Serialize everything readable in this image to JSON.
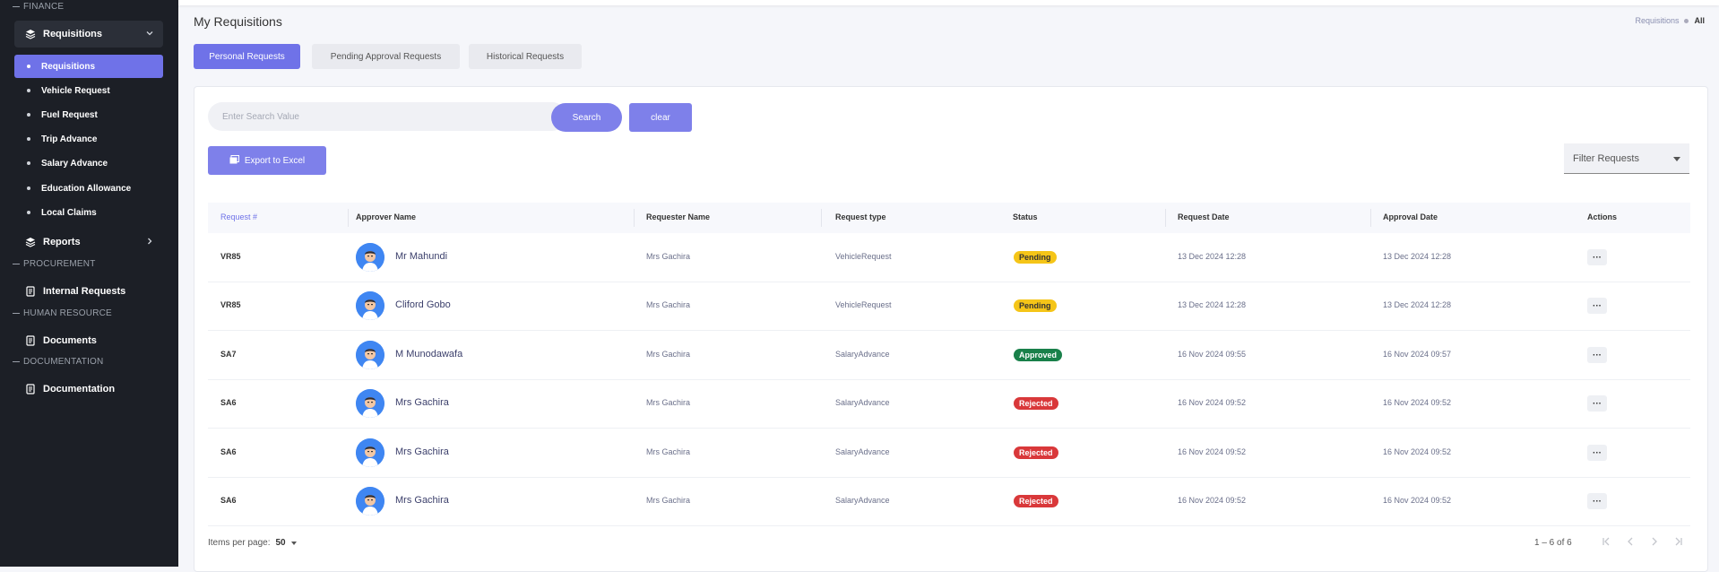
{
  "sidebar": {
    "sections": [
      "FINANCE",
      "PROCUREMENT",
      "HUMAN RESOURCE",
      "DOCUMENTATION"
    ],
    "group_requisitions": "Requisitions",
    "items": [
      "Requisitions",
      "Vehicle Request",
      "Fuel Request",
      "Trip Advance",
      "Salary Advance",
      "Education Allowance",
      "Local Claims"
    ],
    "reports": "Reports",
    "internal_requests": "Internal Requests",
    "documents": "Documents",
    "documentation": "Documentation"
  },
  "header": {
    "title": "My Requisitions",
    "breadcrumb": [
      "Requisitions",
      "All"
    ]
  },
  "tabs": [
    "Personal Requests",
    "Pending Approval Requests",
    "Historical Requests"
  ],
  "search": {
    "placeholder": "Enter Search Value",
    "button": "Search",
    "clear": "clear"
  },
  "export_label": "Export to Excel",
  "filter_label": "Filter Requests",
  "table": {
    "columns": [
      "Request #",
      "Approver Name",
      "Requester Name",
      "Request type",
      "Status",
      "Request Date",
      "Approval Date",
      "Actions"
    ],
    "rows": [
      {
        "id": "VR85",
        "approver": "Mr Mahundi",
        "requester": "Mrs Gachira",
        "type": "VehicleRequest",
        "status": "Pending",
        "request_date": "13 Dec 2024 12:28",
        "approval_date": "13 Dec 2024 12:28"
      },
      {
        "id": "VR85",
        "approver": "Cliford Gobo",
        "requester": "Mrs Gachira",
        "type": "VehicleRequest",
        "status": "Pending",
        "request_date": "13 Dec 2024 12:28",
        "approval_date": "13 Dec 2024 12:28"
      },
      {
        "id": "SA7",
        "approver": "M Munodawafa",
        "requester": "Mrs Gachira",
        "type": "SalaryAdvance",
        "status": "Approved",
        "request_date": "16 Nov 2024 09:55",
        "approval_date": "16 Nov 2024 09:57"
      },
      {
        "id": "SA6",
        "approver": "Mrs Gachira",
        "requester": "Mrs Gachira",
        "type": "SalaryAdvance",
        "status": "Rejected",
        "request_date": "16 Nov 2024 09:52",
        "approval_date": "16 Nov 2024 09:52"
      },
      {
        "id": "SA6",
        "approver": "Mrs Gachira",
        "requester": "Mrs Gachira",
        "type": "SalaryAdvance",
        "status": "Rejected",
        "request_date": "16 Nov 2024 09:52",
        "approval_date": "16 Nov 2024 09:52"
      },
      {
        "id": "SA6",
        "approver": "Mrs Gachira",
        "requester": "Mrs Gachira",
        "type": "SalaryAdvance",
        "status": "Rejected",
        "request_date": "16 Nov 2024 09:52",
        "approval_date": "16 Nov 2024 09:52"
      }
    ],
    "action_glyph": "···"
  },
  "footer": {
    "items_per_page_label": "Items per page:",
    "items_per_page_value": "50",
    "range": "1 – 6 of 6"
  },
  "colors": {
    "accent": "#6f72e8",
    "sidebar_bg": "#1c1f26",
    "pending": "#f5c518",
    "approved": "#19804a",
    "rejected": "#d9383a"
  }
}
